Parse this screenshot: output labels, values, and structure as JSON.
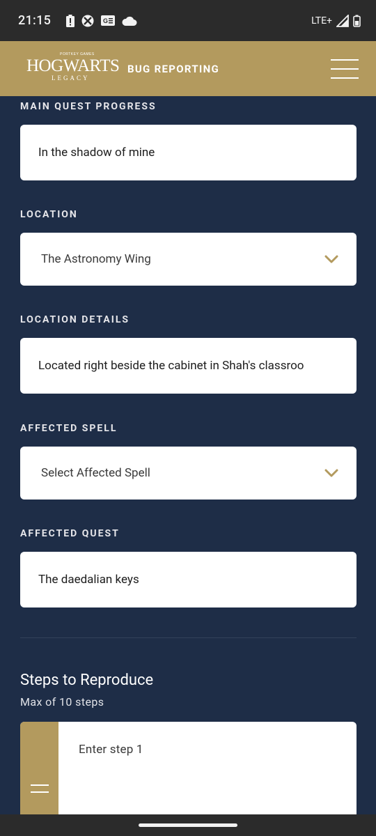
{
  "status": {
    "time": "21:15",
    "network": "LTE+",
    "icons": [
      "alert-battery-icon",
      "xbox-icon",
      "game-card-icon",
      "cloud-icon",
      "signal-icon",
      "battery-icon"
    ]
  },
  "header": {
    "logo_main": "HOGWARTS",
    "logo_sub": "LEGACY",
    "logo_top": "PORTKEY GAMES",
    "title": "BUG REPORTING"
  },
  "form": {
    "main_quest": {
      "label": "MAIN QUEST PROGRESS",
      "value": "In the shadow of mine"
    },
    "location": {
      "label": "LOCATION",
      "value": "The Astronomy Wing"
    },
    "location_details": {
      "label": "LOCATION DETAILS",
      "value": "Located right beside the cabinet in Shah's classroo"
    },
    "affected_spell": {
      "label": "AFFECTED SPELL",
      "value": "Select Affected Spell"
    },
    "affected_quest": {
      "label": "AFFECTED QUEST",
      "value": "The daedalian keys"
    }
  },
  "steps": {
    "title": "Steps to Reproduce",
    "subtitle": "Max of 10 steps",
    "step1_placeholder": "Enter step 1"
  },
  "colors": {
    "accent": "#b39a5e",
    "background": "#1e2d47",
    "status_bar": "#2b2b2b"
  }
}
